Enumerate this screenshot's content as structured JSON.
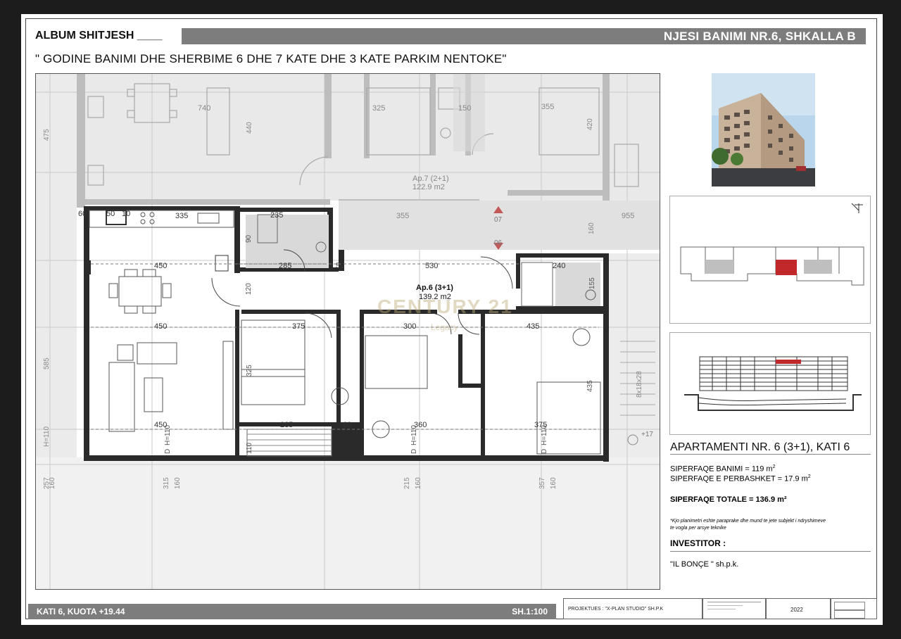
{
  "header": {
    "album_title": "ALBUM SHITJESH ____",
    "unit_title": "NJESI BANIMI NR.6, SHKALLA B",
    "project_title": "\" GODINE BANIMI DHE SHERBIME 6 DHE 7 KATE DHE 3 KATE PARKIM NENTOKE\""
  },
  "plan": {
    "neighbor_unit": "Ap.7 (2+1)",
    "neighbor_area": "122.9 m2",
    "unit_label": "Ap.6 (3+1)",
    "unit_area": "139.2 m2",
    "watermark_brand": "CENTURY 21",
    "watermark_sub": "Legacy",
    "dims": [
      "740",
      "440",
      "475",
      "325",
      "150",
      "355",
      "420",
      "335",
      "235",
      "355",
      "955",
      "160",
      "450",
      "285",
      "530",
      "240",
      "120",
      "90",
      "155",
      "450",
      "375",
      "300",
      "435",
      "325",
      "585",
      "450",
      "285",
      "360",
      "375",
      "435",
      "110",
      "160",
      "315",
      "215",
      "357",
      "60",
      "10",
      "50",
      "D",
      "H=110",
      "07",
      "06",
      "+17"
    ]
  },
  "sidebar": {
    "apartment_title": "APARTAMENTI NR. 6 (3+1), KATI 6",
    "living_area": "SIPERFAQE BANIMI = 119 m",
    "shared_area": "SIPERFAQE E PERBASHKET = 17.9 m",
    "sup": "2",
    "total_area": "SIPERFAQE TOTALE = 136.9 m²",
    "note_line1": "*Kjo planimetri eshte paraprake dhe mund te jete subjekt i ndryshimeve",
    "note_line2": "te vogla per arsye teknike",
    "investor_label": "INVESTITOR :",
    "investor_name": "\"IL BONÇE \" sh.p.k."
  },
  "footer": {
    "floor_level": "KATI 6, KUOTA +19.44",
    "scale": "SH.1:100",
    "designer": "PROJEKTUES :  \"X-PLAN STUDIO\" SH.P.K",
    "year": "2022"
  },
  "colors": {
    "highlight_unit": "#c0282a",
    "banner_gray": "#7d7d7d",
    "wall_dark": "#2a2a2a",
    "grey_fill": "#e6e6e6"
  }
}
